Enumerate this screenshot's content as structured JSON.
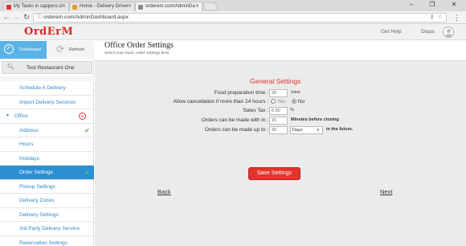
{
  "browser": {
    "tabs": [
      {
        "label": "My Tasks in sapporo.cl",
        "favicon_color": "#d33"
      },
      {
        "label": "Home - Delivery Driver",
        "favicon_color": "#e0a030"
      },
      {
        "label": "orderem.com/AdminDa",
        "favicon_color": "#888"
      }
    ],
    "url": "orderem.com/AdminDashboard.aspx"
  },
  "header": {
    "logo": "OrdErM",
    "get_help": "Get Help",
    "user_name": "Dispa"
  },
  "sidebar": {
    "dashboard_label": "Dashboard",
    "refresh_label": "Refresh",
    "restaurant": "Test Restaurant One",
    "items": [
      {
        "label": "Schedule A Delivery"
      },
      {
        "label": "Import Delivery Services"
      },
      {
        "label": "Office"
      },
      {
        "label": "Address"
      },
      {
        "label": "Hours"
      },
      {
        "label": "Holidays"
      },
      {
        "label": "Order Settings"
      },
      {
        "label": "Pickup Settings"
      },
      {
        "label": "Delivery Zones"
      },
      {
        "label": "Delivery Settings"
      },
      {
        "label": "3rd Party Delivery Service"
      },
      {
        "label": "Reservation Settings"
      }
    ]
  },
  "main": {
    "title": "Office Order Settings",
    "subtitle": "Select your basic order settings here.",
    "section_title": "General Settings",
    "fields": {
      "prep_time": {
        "label": "Food preparation time :",
        "value": "20",
        "suffix": "mins"
      },
      "cancellation": {
        "label": "Allow cancellation if more than 24 hours :",
        "yes": "Yes",
        "no": "No",
        "selected": "No"
      },
      "sales_tax": {
        "label": "Sales Tax :",
        "value": "6.50",
        "suffix": "%"
      },
      "within": {
        "label": "Orders can be made with in :",
        "value": "15",
        "suffix": "Minutes before closing"
      },
      "upto": {
        "label": "Orders can be made up to :",
        "value": "30",
        "unit": "Days",
        "suffix": "in the future."
      }
    },
    "save_label": "Save Settings",
    "back_label": "Back",
    "next_label": "Next"
  }
}
